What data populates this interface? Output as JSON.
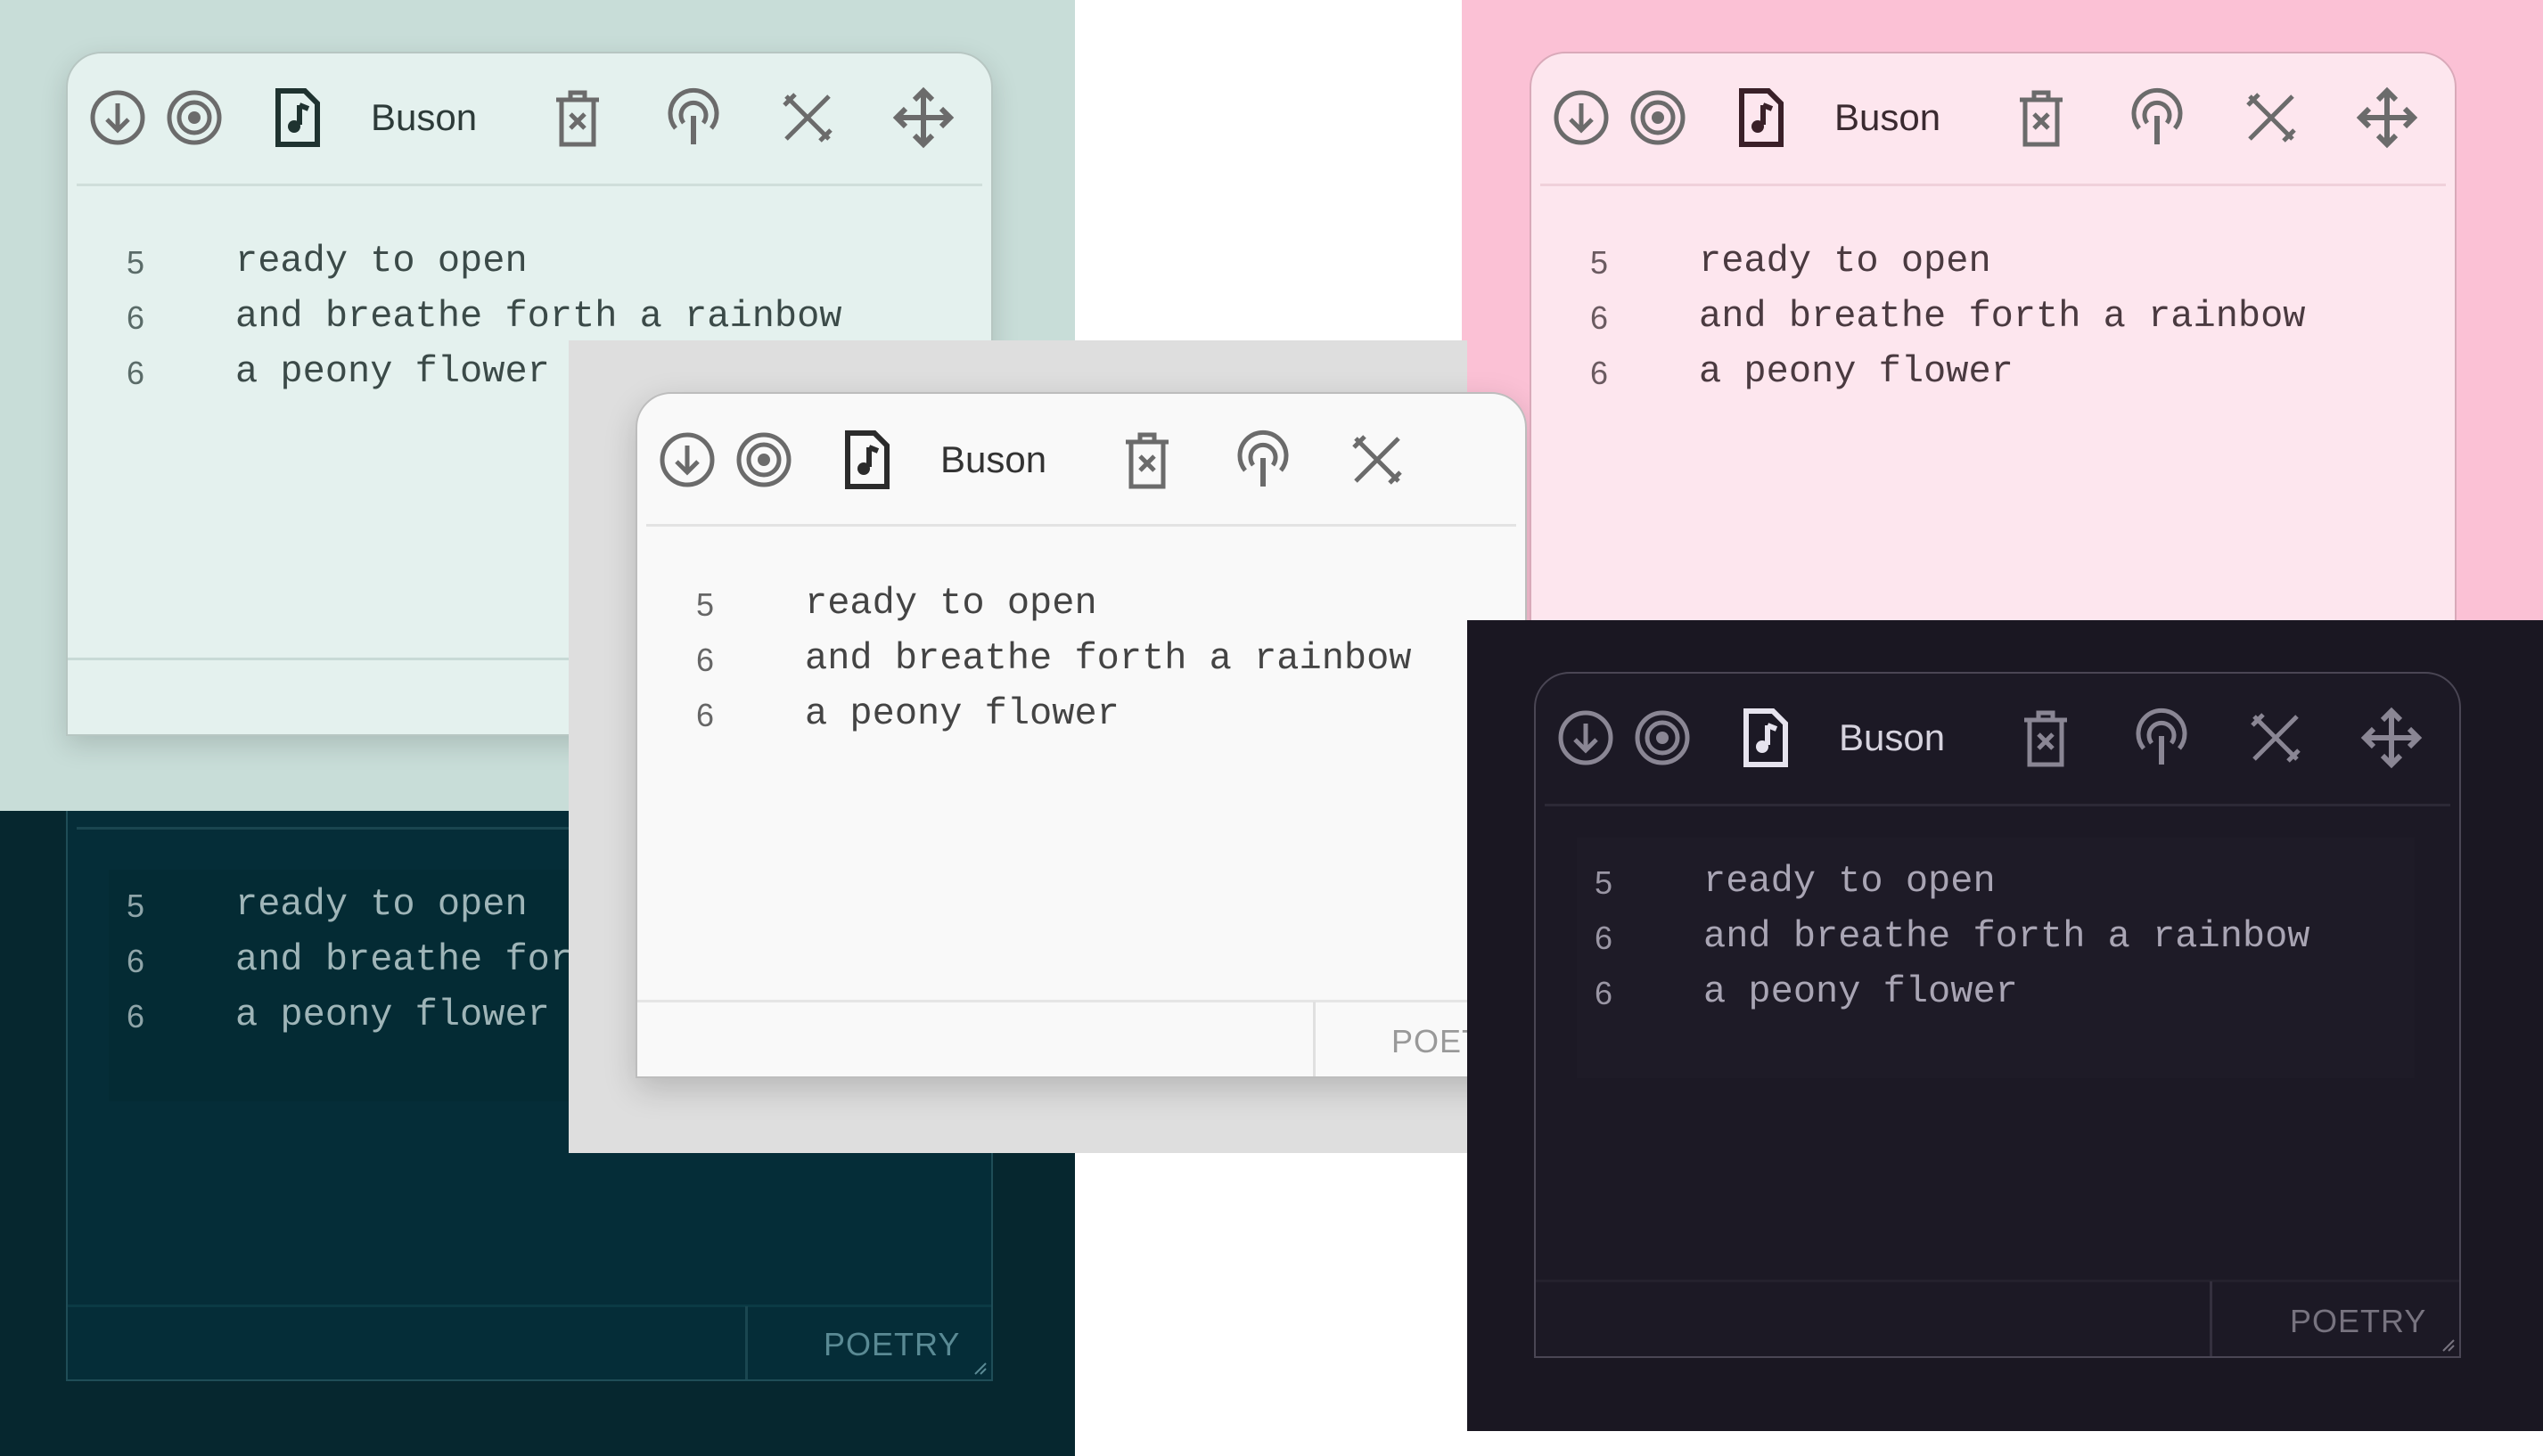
{
  "colors": {
    "mint_bg": "#c8ddd8",
    "mint_win": "#e4f1ee",
    "teal_bg": "#06272f",
    "teal_win": "#052d38",
    "gray_bg": "#dedede",
    "gray_win": "#f9f9f9",
    "pink_bg": "#fbc1d5",
    "pink_win": "#fde6ee",
    "dark_bg": "#1a1722",
    "dark_win": "#1c1925"
  },
  "windows": [
    {
      "id": "mint",
      "title": "Buson",
      "lines": [
        {
          "count": "5",
          "text": "ready to open"
        },
        {
          "count": "6",
          "text": "and breathe forth a rainbow"
        },
        {
          "count": "6",
          "text": "a peony flower"
        }
      ],
      "footer": ""
    },
    {
      "id": "teal",
      "title": "",
      "lines": [
        {
          "count": "5",
          "text": "ready to open"
        },
        {
          "count": "6",
          "text": "and breathe forth a rainbow"
        },
        {
          "count": "6",
          "text": "a peony flower"
        }
      ],
      "footer": "POETRY"
    },
    {
      "id": "gray",
      "title": "Buson",
      "lines": [
        {
          "count": "5",
          "text": "ready to open"
        },
        {
          "count": "6",
          "text": "and breathe forth a rainbow"
        },
        {
          "count": "6",
          "text": "a peony flower"
        }
      ],
      "footer": "POETRY"
    },
    {
      "id": "pink",
      "title": "Buson",
      "lines": [
        {
          "count": "5",
          "text": "ready to open"
        },
        {
          "count": "6",
          "text": "and breathe forth a rainbow"
        },
        {
          "count": "6",
          "text": "a peony flower"
        }
      ],
      "footer": ""
    },
    {
      "id": "dark",
      "title": "Buson",
      "lines": [
        {
          "count": "5",
          "text": "ready to open"
        },
        {
          "count": "6",
          "text": "and breathe forth a rainbow"
        },
        {
          "count": "6",
          "text": "a peony flower"
        }
      ],
      "footer": "POETRY"
    }
  ],
  "icons": [
    "download-icon",
    "target-icon",
    "music-file-icon",
    "delete-icon",
    "podcast-icon",
    "tools-icon",
    "move-icon"
  ]
}
